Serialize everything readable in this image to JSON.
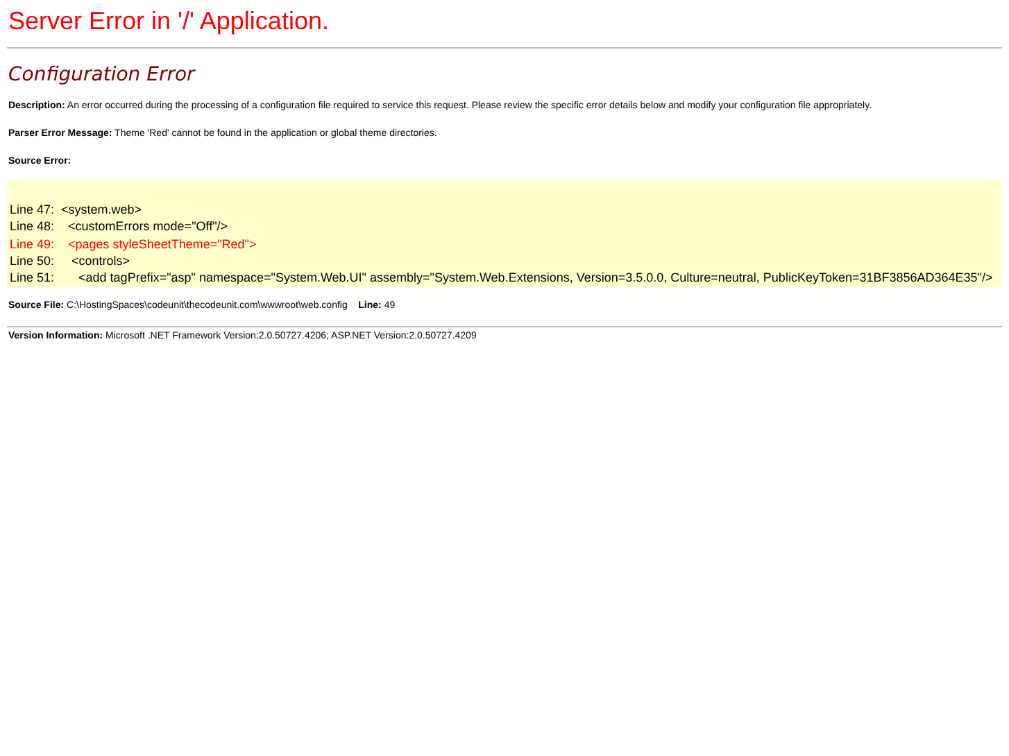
{
  "page_title": "Server Error in '/' Application.",
  "error_title": "Configuration Error",
  "description": {
    "label": "Description:",
    "text": "An error occurred during the processing of a configuration file required to service this request. Please review the specific error details below and modify your configuration file appropriately."
  },
  "parser_error": {
    "label": "Parser Error Message:",
    "text": "Theme 'Red' cannot be found in the application or global theme directories."
  },
  "source_error": {
    "label": "Source Error:"
  },
  "source_lines": [
    {
      "number": "Line 47:",
      "code": "<system.web>",
      "highlighted": false
    },
    {
      "number": "Line 48:",
      "code": "  <customErrors mode=\"Off\"/>",
      "highlighted": false
    },
    {
      "number": "Line 49:",
      "code": "  <pages styleSheetTheme=\"Red\">",
      "highlighted": true
    },
    {
      "number": "Line 50:",
      "code": "   <controls>",
      "highlighted": false
    },
    {
      "number": "Line 51:",
      "code": "     <add tagPrefix=\"asp\" namespace=\"System.Web.UI\" assembly=\"System.Web.Extensions, Version=3.5.0.0, Culture=neutral, PublicKeyToken=31BF3856AD364E35\"/>",
      "highlighted": false
    }
  ],
  "source_file": {
    "label": "Source File:",
    "path": "C:\\HostingSpaces\\codeunit\\thecodeunit.com\\wwwroot\\web.config",
    "line_label": "Line:",
    "line": "49"
  },
  "version": {
    "label": "Version Information:",
    "text": "Microsoft .NET Framework Version:2.0.50727.4206; ASP.NET Version:2.0.50727.4209"
  }
}
